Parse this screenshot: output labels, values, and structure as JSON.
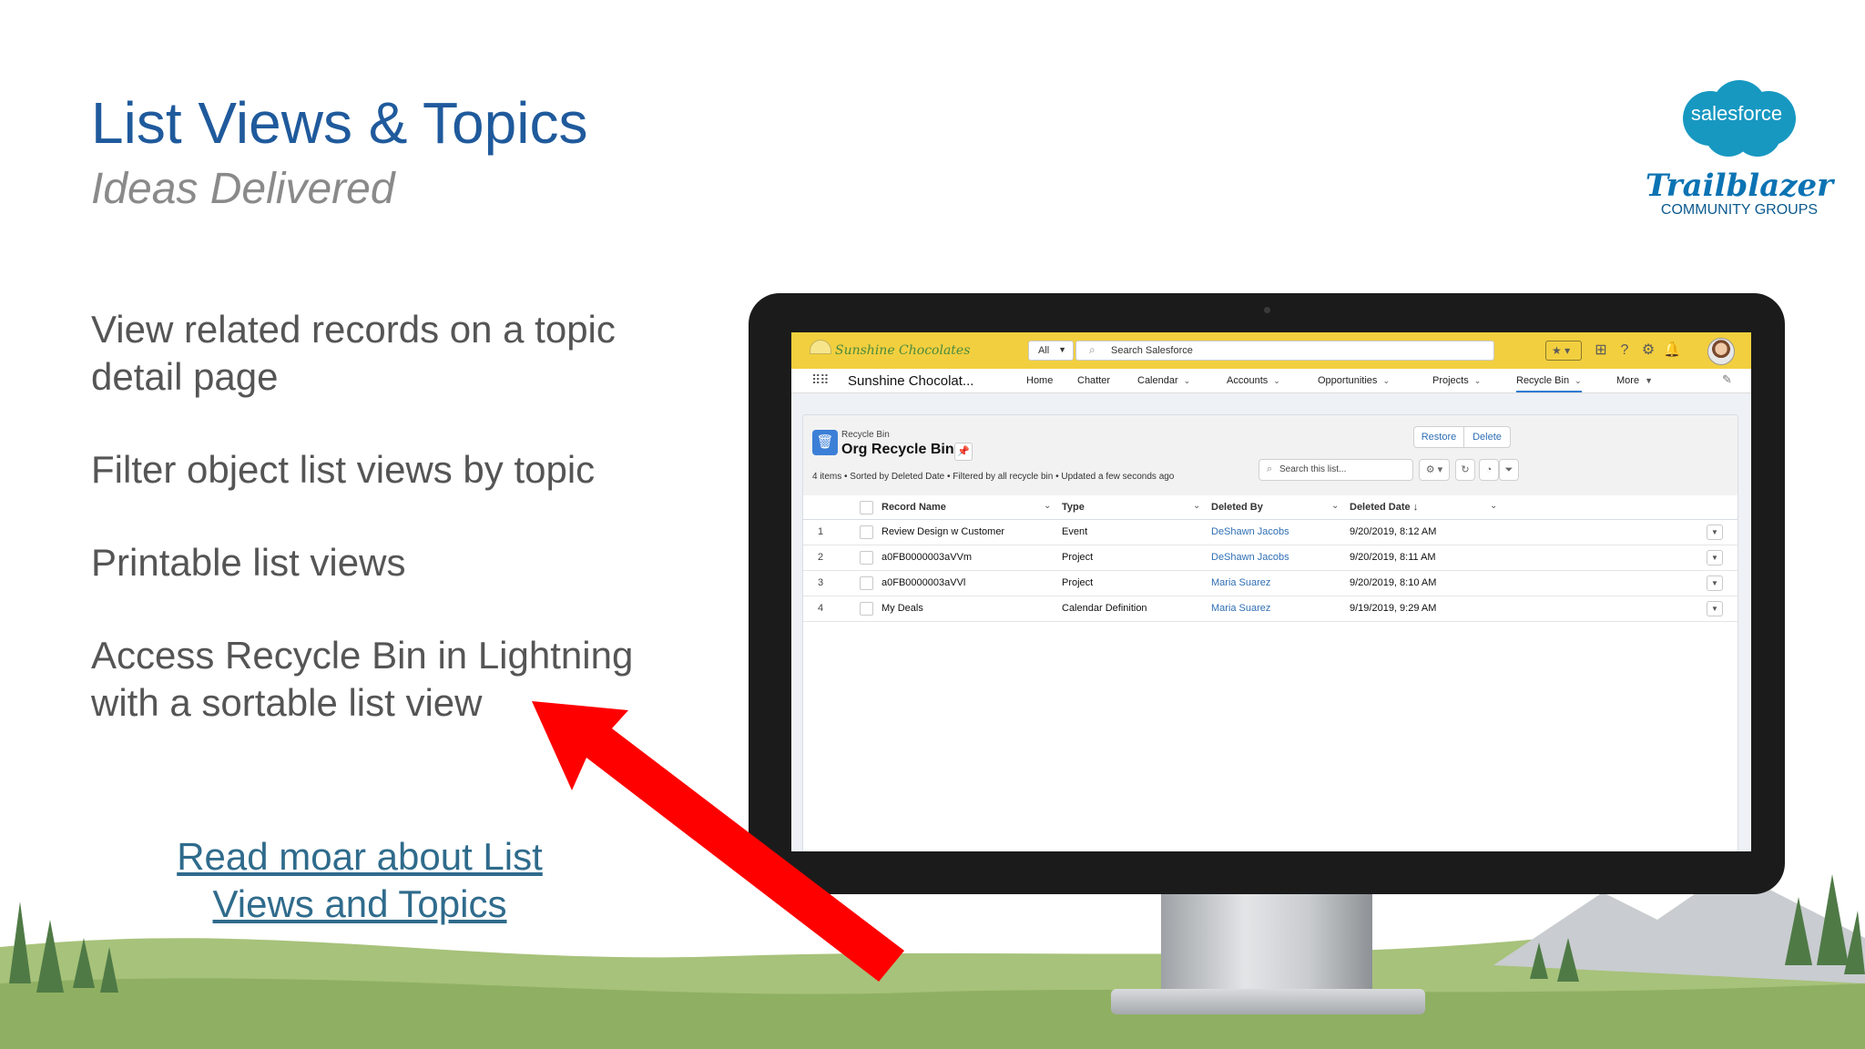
{
  "slide": {
    "title": "List Views & Topics",
    "subtitle": "Ideas Delivered",
    "bullets": [
      "View related records on a topic detail page",
      "Filter object list views by topic",
      "Printable list views",
      "Access Recycle Bin in Lightning with a sortable list view"
    ],
    "link": "Read moar about List Views and Topics"
  },
  "logos": {
    "salesforce": "salesforce",
    "trailblazer": "Trailblazer",
    "community": "COMMUNITY GROUPS"
  },
  "app": {
    "brand": "Sunshine Chocolates",
    "search_scope": "All",
    "search_placeholder": "Search Salesforce",
    "app_name": "Sunshine Chocolat...",
    "nav": [
      "Home",
      "Chatter",
      "Calendar",
      "Accounts",
      "Opportunities",
      "Projects",
      "Recycle Bin",
      "More"
    ],
    "object_label": "Recycle Bin",
    "view_name": "Org Recycle Bin",
    "buttons": {
      "restore": "Restore",
      "delete": "Delete"
    },
    "meta": "4 items • Sorted by Deleted Date • Filtered by all recycle bin • Updated a few seconds ago",
    "list_search_placeholder": "Search this list...",
    "columns": [
      "Record Name",
      "Type",
      "Deleted By",
      "Deleted Date ↓"
    ],
    "rows": [
      {
        "num": "1",
        "name": "Review Design w Customer",
        "type": "Event",
        "deleted_by": "DeShawn Jacobs",
        "date": "9/20/2019, 8:12 AM"
      },
      {
        "num": "2",
        "name": "a0FB0000003aVVm",
        "type": "Project",
        "deleted_by": "DeShawn Jacobs",
        "date": "9/20/2019, 8:11 AM"
      },
      {
        "num": "3",
        "name": "a0FB0000003aVVl",
        "type": "Project",
        "deleted_by": "Maria Suarez",
        "date": "9/20/2019, 8:10 AM"
      },
      {
        "num": "4",
        "name": "My Deals",
        "type": "Calendar Definition",
        "deleted_by": "Maria Suarez",
        "date": "9/19/2019, 9:29 AM"
      }
    ]
  },
  "colors": {
    "title": "#1f5a9c",
    "header": "#f2cf3f",
    "arrow": "#ff0000",
    "link": "#2f6fb5"
  }
}
